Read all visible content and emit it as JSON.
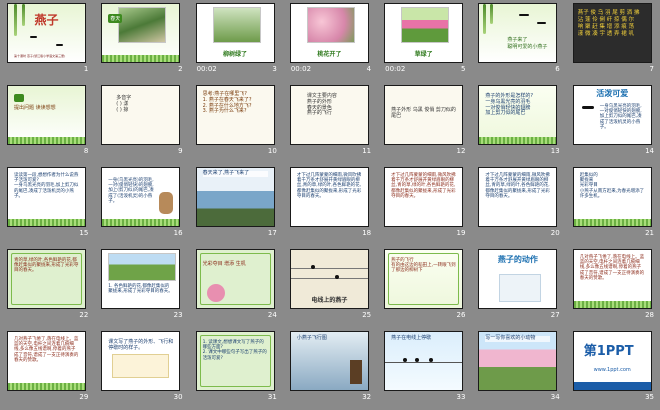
{
  "view": "slide-sorter",
  "slides": [
    {
      "num": "1",
      "title": "燕子",
      "subtitle": "第十课时 燕子(浙江版小学语文第三册)"
    },
    {
      "num": "2",
      "label": "春天"
    },
    {
      "num": "3",
      "time": "00:02",
      "caption": "柳树绿了"
    },
    {
      "num": "4",
      "time": "00:02",
      "caption": "桃花开了"
    },
    {
      "num": "5",
      "time": "00:02",
      "caption": "草绿了"
    },
    {
      "num": "6",
      "line1": "燕子来了",
      "line2": "聪明可爱的小燕子"
    },
    {
      "num": "7",
      "chars": "燕子 俊 乌 羽 尾 剪 洒 拂\n沾 蓬 伶 俐 纤 掠 偶 尔\n响 聚 赶 集 增 添 痕 荡\n漾 微 凑 宇 透 弄 裙 叽"
    },
    {
      "num": "8",
      "line": "提出问题 读读想想"
    },
    {
      "num": "9",
      "line": "多音字\n( ) 漾\n( ) 掠"
    },
    {
      "num": "10",
      "line": "思考:燕子在哪里飞?\n1. 燕子在春天飞来了?\n2. 燕子在什么地方飞?\n3. 燕子为什么飞来?"
    },
    {
      "num": "11",
      "line": "课文主要内容\n燕子的外形\n春天的景色\n燕子的飞行"
    },
    {
      "num": "12",
      "line": "燕子外形 乌黑 俊俏 剪刀似的尾巴"
    },
    {
      "num": "13",
      "line": "燕子的外形是怎样的?\n一身乌黑光亮的羽毛\n一对俊俏轻快的翅膀\n加上剪刀似的尾巴"
    },
    {
      "num": "14",
      "title": "活泼可爱",
      "line": "一身乌黑光亮的羽毛,一对俊俏轻快的翅膀,加上剪刀似的尾巴,凑成了活泼机灵的小燕子。"
    },
    {
      "num": "15",
      "line": "读读第一段,想想作者为什么说燕子活泼可爱?\n一身乌黑光亮的羽毛,加上剪刀似的尾巴,凑成了活泼机灵的小燕子。"
    },
    {
      "num": "16",
      "line": "一身(乌黑光亮)的羽毛,一对(俊俏轻快)的翅膀,加上(剪刀似)的尾巴,凑成了(活泼机灵)的小燕子。"
    },
    {
      "num": "17",
      "line": "春天来了,燕子飞来了"
    },
    {
      "num": "18",
      "line": "才下过几阵蒙蒙的细雨,微风吹拂着千万条才舒展开黄绿眉眼的柳丝,青的草,绿的叶,各色鲜艳的花,都像赶集似的聚拢来,形成了光彩夺目的春天。"
    },
    {
      "num": "19",
      "line": "才下过几阵蒙蒙的细雨,微风吹拂着千万条才舒展开黄绿眉眼的柳丝,青的草,绿的叶,各色鲜艳的花,都像赶集似的聚拢来,形成了光彩夺目的春天。"
    },
    {
      "num": "20",
      "line": "才下过几阵蒙蒙的细雨,微风吹拂着千万条才舒展开黄绿眉眼的柳丝,青的草,绿的叶,各色鲜艳的花,都像赶集似的聚拢来,形成了光彩夺目的春天。"
    },
    {
      "num": "21",
      "line": "赶集似的\n聚拢来\n光彩夺目\n小燕子从南方赶来,为春光增添了许多生机。"
    },
    {
      "num": "22",
      "line": "青的草,绿的叶,各色鲜艳的花,都像赶集似的聚拢来,形成了光彩夺目的春天。"
    },
    {
      "num": "23",
      "line": "1. 各色鲜艳的花,都像赶集似的聚拢来,形成了光彩夺目的春天。"
    },
    {
      "num": "24",
      "line": "光彩夺目 增添 生机"
    },
    {
      "num": "25",
      "caption": "电线上的燕子"
    },
    {
      "num": "26",
      "line": "燕子的飞行\n有的由这边的稻田上,一转眼飞到了那边的柳树下"
    },
    {
      "num": "27",
      "title": "燕子的动作"
    },
    {
      "num": "28",
      "line": "几对燕子飞倦了,落在电线上。蓝蓝的天空,电杆之间连着几痕细线,多么像五线谱啊,停着的燕子成了音符,谱成了一支正待演奏的春天的赞歌。"
    },
    {
      "num": "29",
      "line": "几对燕子飞倦了,落在电线上。蓝蓝的天空,电杆之间连着几痕细线,多么像五线谱啊,停着的燕子成了音符,谱成了一支正待演奏的春天的赞歌。"
    },
    {
      "num": "30",
      "line": "课文写了燕子的外形、飞行和停歇时的样子。"
    },
    {
      "num": "31",
      "line": "1. 读课文,想想课文写了燕子的哪些方面?\n2. 课文中哪些句子写出了燕子的活泼可爱?"
    },
    {
      "num": "32",
      "line": "小燕子飞行图"
    },
    {
      "num": "33",
      "line": "燕子在电线上停歇"
    },
    {
      "num": "34",
      "line": "写一写你喜欢的小动物"
    },
    {
      "num": "35",
      "logo": "第1PPT",
      "line": "www.1ppt.com"
    }
  ]
}
